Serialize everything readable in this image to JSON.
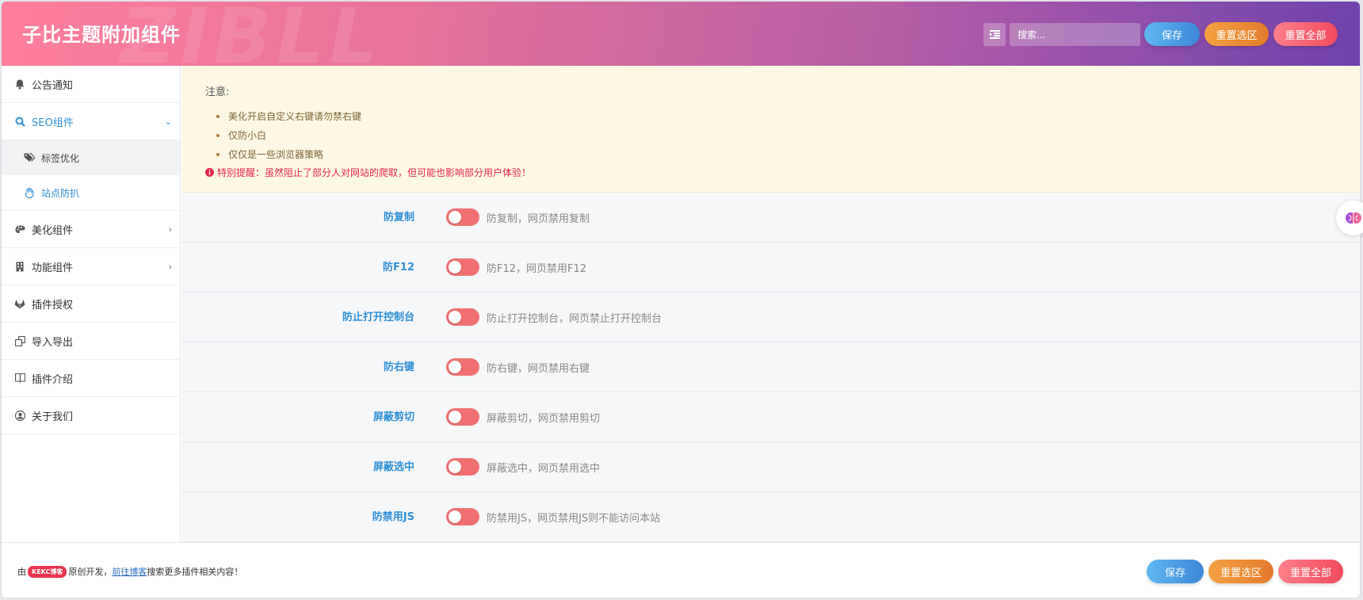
{
  "header": {
    "title": "子比主题附加组件",
    "watermark": "ZIBLL",
    "search_placeholder": "搜索...",
    "save_label": "保存",
    "reset_section_label": "重置选区",
    "reset_all_label": "重置全部"
  },
  "sidebar": {
    "items": [
      {
        "label": "公告通知",
        "icon": "bell-icon"
      },
      {
        "label": "SEO组件",
        "icon": "search-icon",
        "expanded": true,
        "children": [
          {
            "label": "标签优化",
            "icon": "tags-icon"
          },
          {
            "label": "站点防扒",
            "icon": "hand-icon",
            "active": true
          }
        ]
      },
      {
        "label": "美化组件",
        "icon": "palette-icon"
      },
      {
        "label": "功能组件",
        "icon": "building-icon"
      },
      {
        "label": "插件授权",
        "icon": "gitlab-icon"
      },
      {
        "label": "导入导出",
        "icon": "copy-icon"
      },
      {
        "label": "插件介绍",
        "icon": "book-icon"
      },
      {
        "label": "关于我们",
        "icon": "user-circle-icon"
      }
    ]
  },
  "notice": {
    "heading": "注意:",
    "bullets": [
      "美化开启自定义右键请勿禁右键",
      "仅防小白",
      "仅仅是一些浏览器策略"
    ],
    "warning": "特别提醒：虽然阻止了部分人对网站的爬取，但可能也影响部分用户体验！"
  },
  "options": [
    {
      "label": "防复制",
      "desc": "防复制，网页禁用复制",
      "enabled": false
    },
    {
      "label": "防F12",
      "desc": "防F12，网页禁用F12",
      "enabled": false
    },
    {
      "label": "防止打开控制台",
      "desc": "防止打开控制台，网页禁止打开控制台",
      "enabled": false
    },
    {
      "label": "防右键",
      "desc": "防右键，网页禁用右键",
      "enabled": false
    },
    {
      "label": "屏蔽剪切",
      "desc": "屏蔽剪切，网页禁用剪切",
      "enabled": false
    },
    {
      "label": "屏蔽选中",
      "desc": "屏蔽选中，网页禁用选中",
      "enabled": false
    },
    {
      "label": "防禁用JS",
      "desc": "防禁用JS，网页禁用JS则不能访问本站",
      "enabled": false
    }
  ],
  "footer": {
    "prefix": "由",
    "badge": "KEKC博客",
    "middle": "原创开发，",
    "link": "前往博客",
    "suffix": "搜索更多插件相关内容！",
    "save_label": "保存",
    "reset_section_label": "重置选区",
    "reset_all_label": "重置全部"
  },
  "colors": {
    "accent": "#2e8fd6",
    "toggle_off": "#f07070",
    "warning": "#e6254b"
  }
}
